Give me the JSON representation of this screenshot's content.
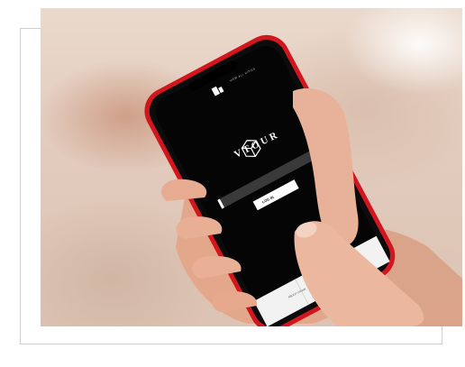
{
  "app": {
    "brand_name": "VTOUR",
    "corner_label": "VIEW ALL CITIES",
    "login_button_label": "LOG IN",
    "field_placeholder": "",
    "bottom_tabs": [
      "ABOUT VTOUR",
      "",
      ""
    ]
  },
  "colors": {
    "phone_body": "#d2161e",
    "screen": "#050505",
    "skin": "#e9b59c",
    "page_background": "#ffffff",
    "frame_border": "#cfcfcf"
  },
  "icons": [
    "cube-logo-icon",
    "building-icon"
  ]
}
